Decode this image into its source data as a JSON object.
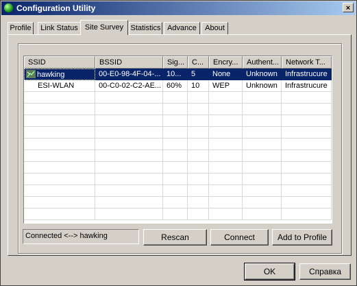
{
  "window": {
    "title": "Configuration Utility",
    "close_glyph": "×"
  },
  "tabs": [
    "Profile",
    "Link Status",
    "Site Survey",
    "Statistics",
    "Advance",
    "About"
  ],
  "active_tab": "Site Survey",
  "table": {
    "columns": [
      "SSID",
      "BSSID",
      "Sig...",
      "C...",
      "Encry...",
      "Authent...",
      "Network T..."
    ],
    "rows": [
      [
        "hawking",
        "00-E0-98-4F-04-...",
        "10...",
        "5",
        "None",
        "Unknown",
        "Infrastrucure"
      ],
      [
        "ESI-WLAN",
        "00-C0-02-C2-AE...",
        "60%",
        "10",
        "WEP",
        "Unknown",
        "Infrastrucure"
      ]
    ],
    "selected_row": 0
  },
  "status": "Connected <--> hawking",
  "buttons": {
    "rescan": "Rescan",
    "connect": "Connect",
    "add_to_profile": "Add to Profile",
    "ok": "OK",
    "help": "Справка"
  },
  "colors": {
    "selection": "#0a246a",
    "face": "#d4d0c8"
  },
  "icons": {
    "connected": "wireless-connected-icon",
    "app": "app-status-icon"
  }
}
